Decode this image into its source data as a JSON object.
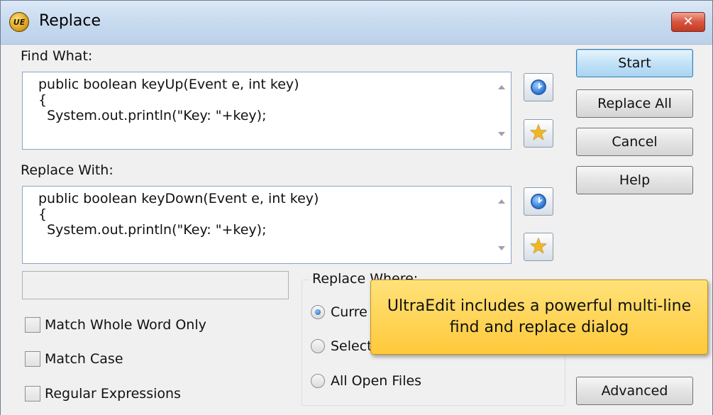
{
  "window": {
    "title": "Replace",
    "app_logo_text": "UE",
    "close_glyph": "✕"
  },
  "find": {
    "label": "Find What:",
    "value": "public boolean keyUp(Event e, int key)\n{\n  System.out.println(\"Key: \"+key);"
  },
  "replace": {
    "label": "Replace With:",
    "value": "public boolean keyDown(Event e, int key)\n{\n  System.out.println(\"Key: \"+key);"
  },
  "buttons": {
    "start": "Start",
    "replace_all": "Replace All",
    "cancel": "Cancel",
    "help": "Help",
    "advanced": "Advanced"
  },
  "icons": {
    "history": "clock-icon",
    "favorites": "star-icon",
    "star_glyph": "★"
  },
  "options": {
    "match_whole_word": "Match Whole Word Only",
    "match_case": "Match Case",
    "regular_expressions": "Regular Expressions"
  },
  "replace_where": {
    "title": "Replace Where:",
    "current_file": "Curre",
    "selection": "Select",
    "all_open_files": "All Open Files"
  },
  "tooltip": "UltraEdit includes a powerful multi-line find and replace dialog",
  "colors": {
    "accent": "#c3e2f7",
    "tooltip_bg": "#ffd24a",
    "close_red": "#d9553f"
  }
}
